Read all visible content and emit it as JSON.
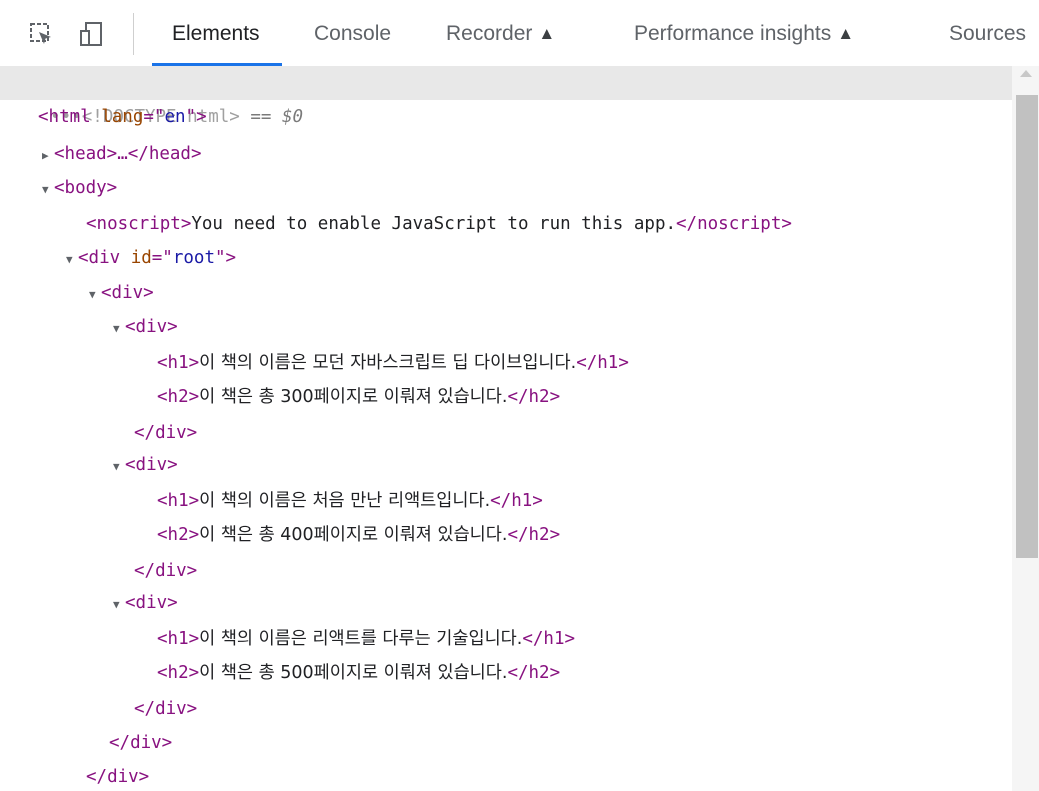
{
  "toolbar": {
    "tabs": [
      {
        "label": "Elements"
      },
      {
        "label": "Console"
      },
      {
        "label": "Recorder"
      },
      {
        "label": "Performance insights"
      },
      {
        "label": "Sources"
      }
    ],
    "flask_glyph": "⏅"
  },
  "elements": {
    "doctype": {
      "ellipsis": "•••",
      "text": "<!DOCTYPE html>",
      "eq": " == $0"
    },
    "html_open": {
      "tag_a": "<html ",
      "attr": "lang",
      "eq": "=\"",
      "val": "en",
      "tag_b": "\">"
    },
    "head": "<head>…</head>",
    "body_open": "<body>",
    "noscript_open": "<noscript>",
    "noscript_text": "You need to enable JavaScript to run this app.",
    "noscript_close": "</noscript>",
    "root_div": {
      "tag_a": "<div ",
      "attr": "id",
      "eq": "=\"",
      "val": "root",
      "tag_b": "\">"
    },
    "div_open": "<div>",
    "div_close": "</div>",
    "h1_open": "<h1>",
    "h1_close": "</h1>",
    "h2_open": "<h2>",
    "h2_close": "</h2>",
    "books": [
      {
        "h1": "이 책의 이름은 모던 자바스크립트 딥 다이브입니다.",
        "h2": "이 책은 총 300페이지로 이뤄져 있습니다."
      },
      {
        "h1": "이 책의 이름은 처음 만난 리액트입니다.",
        "h2": "이 책은 총 400페이지로 이뤄져 있습니다."
      },
      {
        "h1": "이 책의 이름은 리액트를 다루는 기술입니다.",
        "h2": "이 책은 총 500페이지로 이뤄져 있습니다."
      }
    ]
  }
}
